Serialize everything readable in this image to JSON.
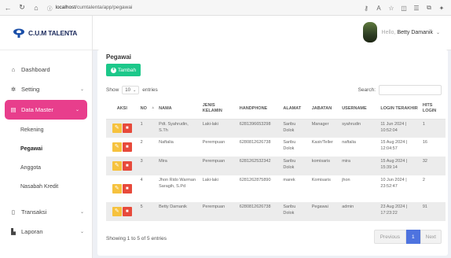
{
  "browser": {
    "url_host": "localhost",
    "url_path": "/cumtalenta/app/pegawai"
  },
  "brand": {
    "name": "C.U.M TALENTA"
  },
  "user": {
    "greeting": "Hello,",
    "name": "Betty Damanik"
  },
  "sidebar": {
    "items": [
      {
        "label": "Dashboard",
        "icon": "home-icon"
      },
      {
        "label": "Setting",
        "icon": "gear-icon"
      },
      {
        "label": "Data Master",
        "icon": "database-icon"
      }
    ],
    "subitems": [
      {
        "label": "Rekening"
      },
      {
        "label": "Pegawai"
      },
      {
        "label": "Anggota"
      },
      {
        "label": "Nasabah Kredit"
      }
    ],
    "bottom_items": [
      {
        "label": "Transaksi",
        "icon": "document-icon"
      },
      {
        "label": "Laporan",
        "icon": "chart-icon"
      }
    ]
  },
  "page": {
    "title": "Pegawai",
    "add_label": "Tambah",
    "show_prefix": "Show",
    "show_value": "10",
    "show_suffix": "entries",
    "search_label": "Search:",
    "info": "Showing 1 to 5 of 5 entries",
    "pager": {
      "prev": "Previous",
      "current": "1",
      "next": "Next"
    }
  },
  "table": {
    "headers": {
      "aksi": "AKSI",
      "no": "NO",
      "nama": "NAMA",
      "jenis_kelamin": "JENIS KELAMIN",
      "handphone": "HANDPHONE",
      "alamat": "ALAMAT",
      "jabatan": "JABATAN",
      "username": "USERNAME",
      "login_terakhir": "LOGIN TERAKHIR",
      "hits_login": "HITS LOGIN"
    },
    "rows": [
      {
        "no": "1",
        "nama": "Pdt. Syahrudin, S.Th",
        "jk": "Laki-laki",
        "hp": "6281396653298",
        "alamat": "Saribu Dolok",
        "jabatan": "Manager",
        "username": "syahrudin",
        "login": "11 Jun 2024 | 10:52:04",
        "hits": "1"
      },
      {
        "no": "2",
        "nama": "Naftalia",
        "jk": "Perempuan",
        "hp": "6280812626738",
        "alamat": "Saribu Dolok",
        "jabatan": "Kasir/Teller",
        "username": "naftalia",
        "login": "15 Aug 2024 | 12:04:57",
        "hits": "16"
      },
      {
        "no": "3",
        "nama": "Mira",
        "jk": "Perempuan",
        "hp": "6281262532342",
        "alamat": "Saribu Dolok",
        "jabatan": "komisaris",
        "username": "mira",
        "login": "15 Aug 2024 | 15:39:14",
        "hits": "32"
      },
      {
        "no": "4",
        "nama": "Jhon Rido Warman Saragih, S.Pd",
        "jk": "Laki-laki",
        "hp": "6281262875890",
        "alamat": "marek",
        "jabatan": "Komisaris",
        "username": "jhon",
        "login": "10 Jun 2024 | 23:52:47",
        "hits": "2"
      },
      {
        "no": "5",
        "nama": "Betty Damanik",
        "jk": "Perempuan",
        "hp": "6280812626738",
        "alamat": "Saribu Dolok",
        "jabatan": "Pegawai",
        "username": "admin",
        "login": "23 Aug 2024 | 17:23:22",
        "hits": "91"
      }
    ]
  }
}
